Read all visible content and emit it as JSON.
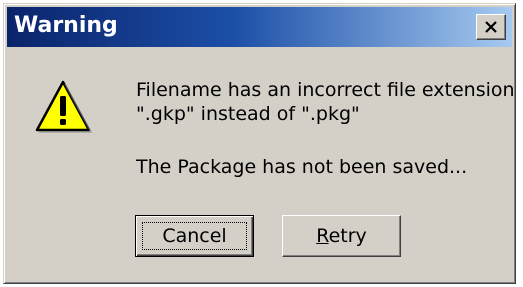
{
  "window": {
    "title": "Warning"
  },
  "icon": "warning-icon",
  "message": {
    "line1": "Filename has an incorrect file extension",
    "line2": "\".gkp\" instead of \".pkg\"",
    "line3": "The Package has not been saved..."
  },
  "buttons": {
    "cancel_label": "Cancel",
    "retry_mnemonic": "R",
    "retry_rest": "etry"
  },
  "colors": {
    "title_bar_start": "#0a246a",
    "title_bar_end": "#a6caf0",
    "dialog_face": "#d4d0c8",
    "warning_yellow": "#ffff00"
  }
}
